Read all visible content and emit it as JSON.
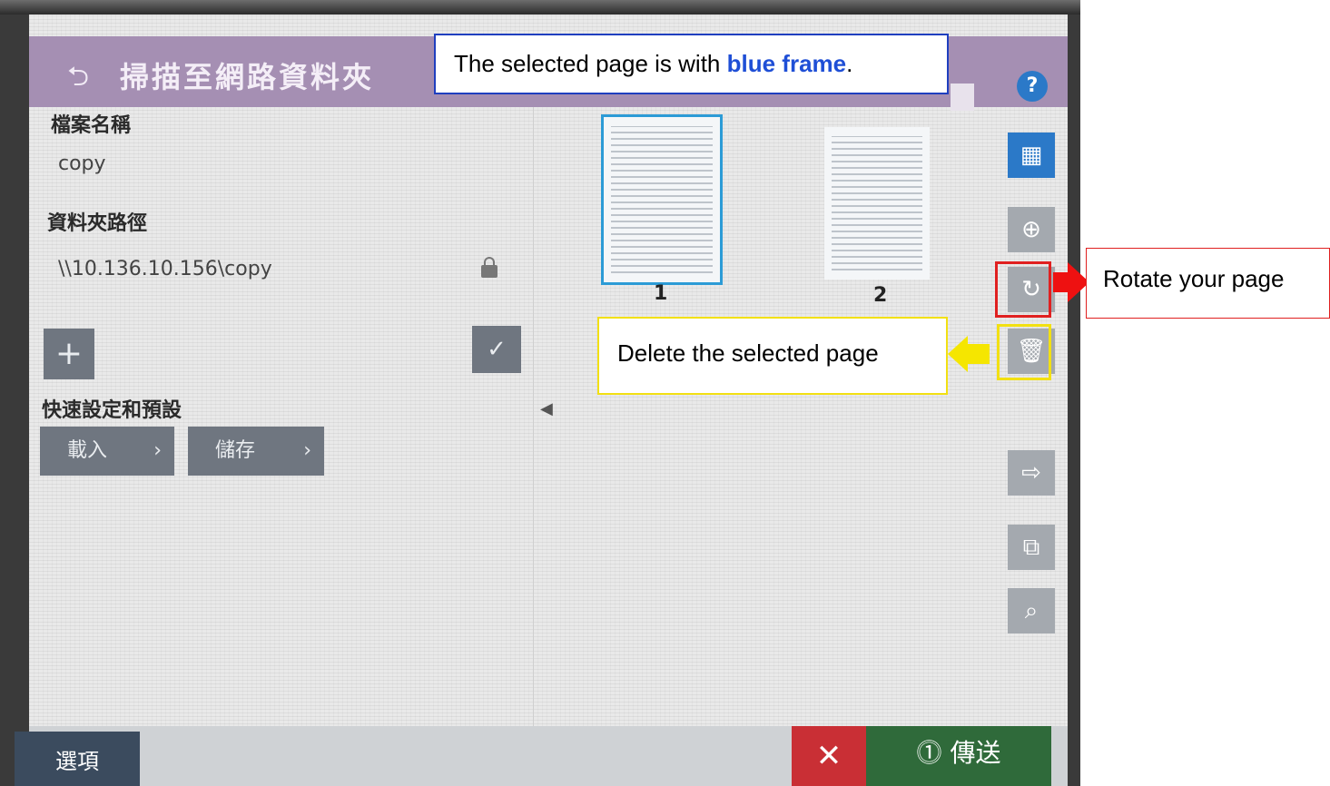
{
  "header": {
    "title": "掃描至網路資料夾"
  },
  "fields": {
    "file_name_label": "檔案名稱",
    "file_name_value": "copy",
    "folder_path_label": "資料夾路徑",
    "folder_path_value": "\\\\10.136.10.156\\copy"
  },
  "quick_sets": {
    "label": "快速設定和預設",
    "load_label": "載入",
    "save_label": "儲存"
  },
  "thumbnails": [
    {
      "number": "1",
      "selected": true
    },
    {
      "number": "2",
      "selected": false
    }
  ],
  "bottom": {
    "options_label": "選項",
    "send_label": "傳送"
  },
  "annotations": {
    "selected_prefix": "The selected page is with ",
    "selected_highlight": "blue frame",
    "selected_suffix": ".",
    "rotate": "Rotate your page",
    "delete": "Delete the selected page"
  },
  "icons": {
    "back": "back-arrow-icon",
    "help": "help-icon",
    "grid": "grid-view-icon",
    "zoom": "zoom-in-icon",
    "rotate": "rotate-icon",
    "delete": "trash-icon",
    "move": "move-page-icon",
    "copy": "copy-page-icon",
    "preview": "preview-icon",
    "lock": "lock-icon",
    "add": "plus-icon",
    "check": "check-icon"
  },
  "colors": {
    "header": "#a58fb3",
    "selected_frame": "#2c9bd6",
    "send": "#2f6a3a",
    "cancel": "#c92f35"
  }
}
